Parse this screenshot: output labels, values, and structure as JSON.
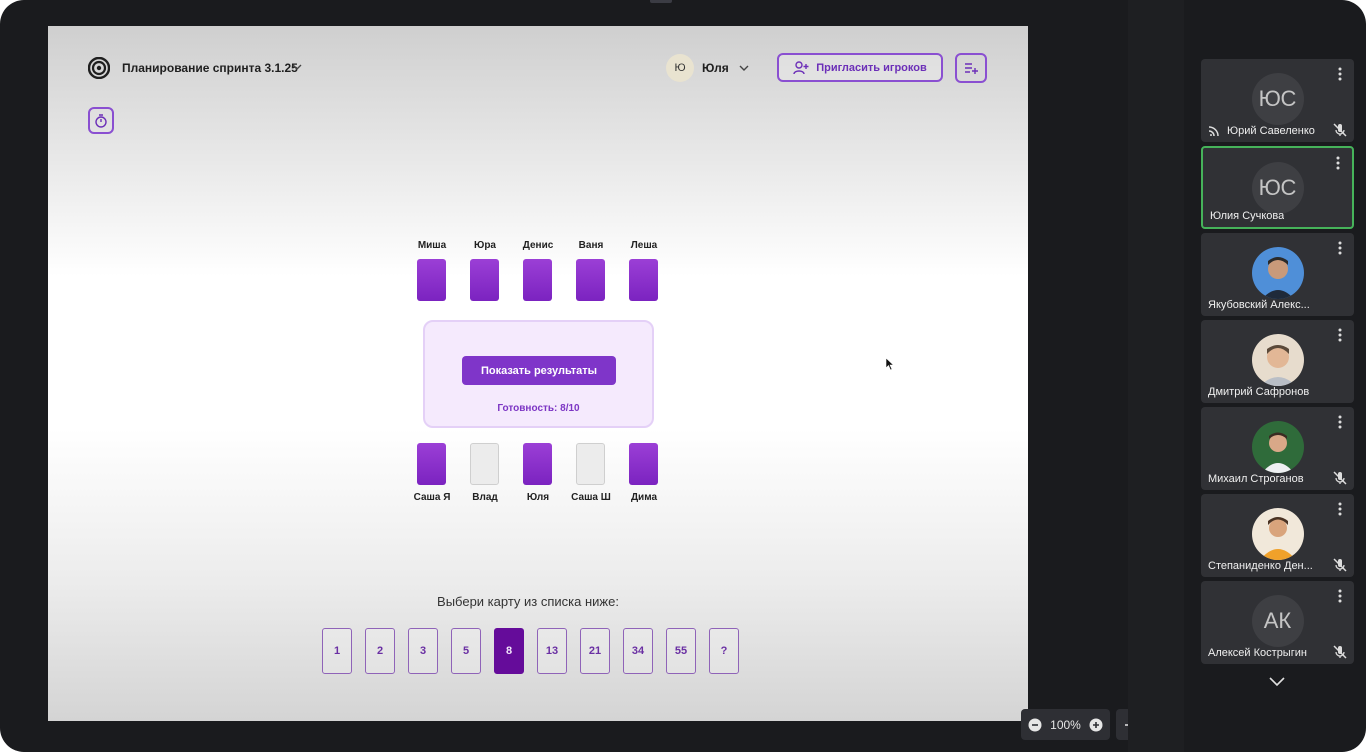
{
  "app": {
    "room_title": "Планирование спринта 3.1.25",
    "user_initial": "Ю",
    "user_name": "Юля",
    "invite_label": "Пригласить игроков"
  },
  "table": {
    "top_players": [
      {
        "name": "Миша",
        "voted": true
      },
      {
        "name": "Юра",
        "voted": true
      },
      {
        "name": "Денис",
        "voted": true
      },
      {
        "name": "Ваня",
        "voted": true
      },
      {
        "name": "Леша",
        "voted": true
      }
    ],
    "bottom_players": [
      {
        "name": "Саша Я",
        "voted": true
      },
      {
        "name": "Влад",
        "voted": false
      },
      {
        "name": "Юля",
        "voted": true
      },
      {
        "name": "Саша Ш",
        "voted": false
      },
      {
        "name": "Дима",
        "voted": true
      }
    ],
    "show_results_label": "Показать результаты",
    "readiness": "Готовность: 8/10"
  },
  "deck": {
    "prompt": "Выбери карту из списка ниже:",
    "cards": [
      "1",
      "2",
      "3",
      "5",
      "8",
      "13",
      "21",
      "34",
      "55",
      "?"
    ],
    "selected": "8"
  },
  "controls": {
    "zoom": "100%"
  },
  "participants": [
    {
      "initials": "ЮС",
      "name": "Юрий Савеленко",
      "speaking": true,
      "muted": true,
      "active": false,
      "photo": null
    },
    {
      "initials": "ЮС",
      "name": "Юлия Сучкова",
      "speaking": false,
      "muted": false,
      "active": true,
      "photo": null
    },
    {
      "initials": "",
      "name": "Якубовский Алекс...",
      "speaking": false,
      "muted": false,
      "active": false,
      "photo": "avatar-1"
    },
    {
      "initials": "",
      "name": "Дмитрий Сафронов",
      "speaking": false,
      "muted": false,
      "active": false,
      "photo": "avatar-2"
    },
    {
      "initials": "",
      "name": "Михаил Строганов",
      "speaking": false,
      "muted": true,
      "active": false,
      "photo": "avatar-3"
    },
    {
      "initials": "",
      "name": "Степаниденко Ден...",
      "speaking": false,
      "muted": true,
      "active": false,
      "photo": "avatar-4"
    },
    {
      "initials": "АК",
      "name": "Алексей Кострыгин",
      "speaking": false,
      "muted": true,
      "active": false,
      "photo": null
    }
  ],
  "colors": {
    "accent": "#7f35c9",
    "card_selected": "#650c9a",
    "active_tile_border": "#46b35a"
  }
}
